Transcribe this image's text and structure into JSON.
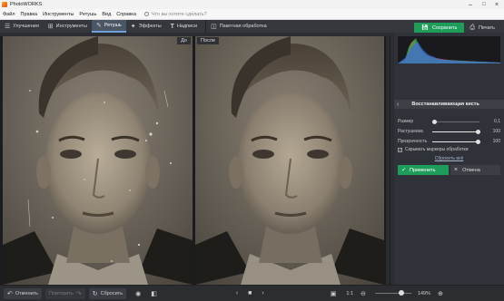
{
  "window": {
    "title": "PhotoWORKS",
    "minimize_icon": "minimize-icon",
    "maximize_icon": "maximize-icon",
    "close_icon": "close-icon"
  },
  "menu": {
    "items": [
      "Файл",
      "Правка",
      "Инструменты",
      "Ретушь",
      "Вид",
      "Справка"
    ],
    "search_placeholder": "Что вы хотите сделать?"
  },
  "toolbar": {
    "tabs": [
      {
        "label": "Улучшения",
        "icon": "sliders-icon",
        "active": false
      },
      {
        "label": "Инструменты",
        "icon": "crop-icon",
        "active": false
      },
      {
        "label": "Ретушь",
        "icon": "brush-icon",
        "active": true
      },
      {
        "label": "Эффекты",
        "icon": "magic-wand-icon",
        "active": false
      },
      {
        "label": "Надписи",
        "icon": "text-icon",
        "active": false
      }
    ],
    "batch_label": "Пакетная обработка",
    "save_label": "Сохранить",
    "print_label": "Печать"
  },
  "canvas": {
    "before_label": "До",
    "after_label": "После"
  },
  "panel": {
    "title": "Восстанавливающая кисть",
    "sliders": [
      {
        "label": "Размер",
        "value": "0,1",
        "level": 0.05
      },
      {
        "label": "Растушевка",
        "value": "100",
        "level": 1.0
      },
      {
        "label": "Прозрачность",
        "value": "100",
        "level": 1.0
      }
    ],
    "show_markers_label": "Скрывать маркеры обработки",
    "reset_all_label": "Сбросить всё",
    "apply_label": "Применить",
    "cancel_label": "Отмена"
  },
  "bottom": {
    "undo_label": "Отменить",
    "redo_label": "Повторить",
    "reset_label": "Сбросить",
    "zoom_ratio": "1:1",
    "zoom_percent": "149%"
  }
}
